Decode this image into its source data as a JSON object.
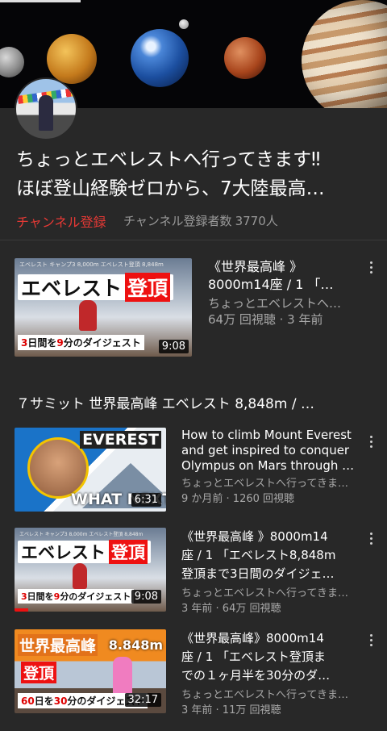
{
  "channel": {
    "title_lines": [
      "ちょっとエベレストへ行ってきます‼",
      "ほぼ登山経験ゼロから、7大陸最高…"
    ],
    "subscribe_label": "チャンネル登録",
    "subscriber_label": "チャンネル登録者数",
    "subscriber_count": "3770人"
  },
  "featured": {
    "title_lines": [
      "《世界最高峰 》",
      "8000m14座 / 1 「…"
    ],
    "channel": "ちょっとエベレストへ…",
    "stats": "64万 回視聴 · 3 年前",
    "duration": "9:08",
    "thumb": {
      "header": "エベレスト キャンプ3 8,000m エベレスト登頂 8,848m",
      "big_text": "エベレスト",
      "big_red": "登頂",
      "sub_pre": "3",
      "sub_mid1": "日間を",
      "sub_num": "9",
      "sub_end": "分のダイジェスト"
    }
  },
  "section": {
    "title": "７サミット 世界最高峰 エベレスト 8,848m  / …"
  },
  "videos": [
    {
      "title_lines": [
        "How to climb Mount Everest",
        "and get inspired to conquer",
        "Olympus on Mars through …"
      ],
      "meta_lines": [
        "ちょっとエベレストへ行ってきま…",
        "9 か月前 · 1260 回視聴"
      ],
      "duration": "6:31",
      "thumb_top": "EVEREST",
      "thumb_bottom": "WHAT NEXT?"
    },
    {
      "title_lines": [
        "《世界最高峰 》8000m14",
        "座 / 1 「エベレスト8,848m",
        "登頂まで3日間のダイジェ…"
      ],
      "meta_lines": [
        "ちょっとエベレストへ行ってきま…",
        "3 年前 · 64万 回視聴"
      ],
      "duration": "9:08",
      "watched_fraction": 0.09
    },
    {
      "title_lines": [
        "《世界最高峰》8000m14",
        "座 / 1 「エベレスト登頂ま",
        "での１ヶ月半を30分のダ…"
      ],
      "meta_lines": [
        "ちょっとエベレストへ行ってきま…",
        "3 年前 · 11万 回視聴"
      ],
      "duration": "32:17",
      "thumb_gold": "世界最高峰",
      "thumb_alt": "8.848m",
      "thumb_red": "登頂",
      "thumb_sub_a": "60",
      "thumb_sub_b": "日を",
      "thumb_sub_c": "30",
      "thumb_sub_d": "分のダイジェスト"
    }
  ],
  "colors": {
    "background": "#282828",
    "subscribe": "#e53935",
    "progress": "#ee1111"
  },
  "icons": [
    "more-vert-icon"
  ]
}
